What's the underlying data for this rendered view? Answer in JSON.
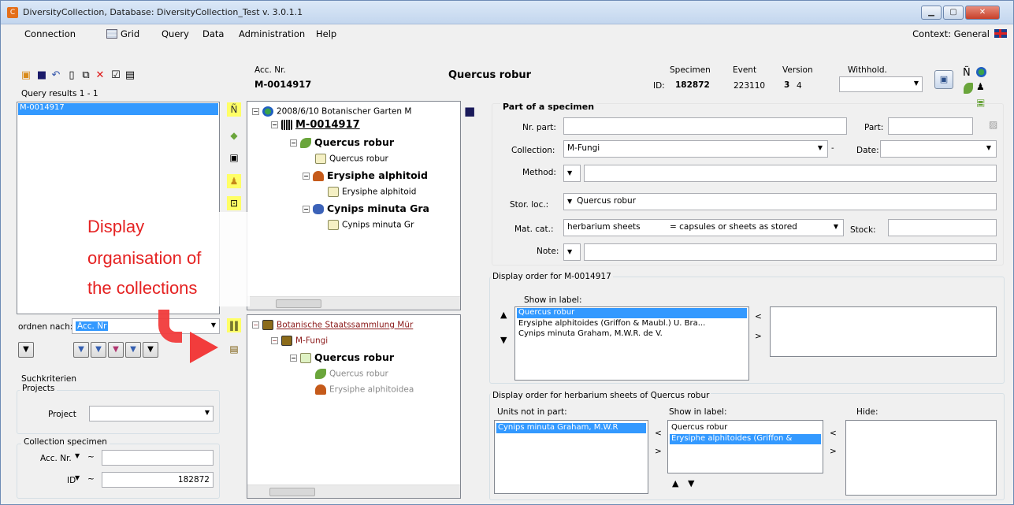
{
  "window": {
    "title": "DiversityCollection,  Database: DiversityCollection_Test   v. 3.0.1.1",
    "minimize": "▁",
    "maximize": "▢",
    "close": "✕"
  },
  "menu": [
    "Connection",
    "Grid",
    "Query",
    "Data",
    "Administration",
    "Help"
  ],
  "context": "Context: General",
  "header": {
    "acc_nr_label": "Acc. Nr.",
    "acc_nr_value": "M-0014917",
    "title": "Quercus robur",
    "id_label": "ID:",
    "specimen_label": "Specimen",
    "specimen_value": "182872",
    "event_label": "Event",
    "event_value": "223110",
    "version_label": "Version",
    "version_value": "3",
    "version_value2": "4",
    "withhold_label": "Withhold."
  },
  "query": {
    "results_label": "Query results   1 - 1",
    "results": [
      "M-0014917"
    ],
    "order_label": "ordnen nach:",
    "order_value": "Acc. Nr",
    "search_criteria_label": "Suchkriterien",
    "projects_group": "Projects",
    "project_label": "Project",
    "collection_specimen_group": "Collection specimen",
    "acc_nr_label": "Acc. Nr.",
    "id_label": "ID",
    "id_value": "182872",
    "tilde": "~"
  },
  "tree_top": {
    "event": "2008/6/10 Botanischer Garten M",
    "specimen": "M-0014917",
    "unit1": "Quercus robur",
    "unit1_label": "Quercus robur",
    "unit2": "Erysiphe alphitoid",
    "unit2_label": "Erysiphe alphitoid",
    "unit3": "Cynips minuta Gra",
    "unit3_label": "Cynips minuta Gr"
  },
  "tree_bottom": {
    "collection": "Botanische Staatssammlung Mür",
    "subcollection": "M-Fungi",
    "part": "Quercus robur",
    "unit1": "Quercus robur",
    "unit2": "Erysiphe alphitoidea"
  },
  "annotation": {
    "line1": "Display",
    "line2": "organisation of",
    "line3": "the collections"
  },
  "part": {
    "section_title": "Part of a specimen",
    "nr_part_label": "Nr. part:",
    "part_label": "Part:",
    "collection_label": "Collection:",
    "collection_value": "M-Fungi",
    "date_label": "Date:",
    "method_label": "Method:",
    "stor_loc_label": "Stor. loc.:",
    "stor_loc_value": "Quercus robur",
    "mat_cat_label": "Mat. cat.:",
    "mat_cat_value": "herbarium sheets",
    "mat_cat_desc": "= capsules or sheets as stored",
    "stock_label": "Stock:",
    "note_label": "Note:"
  },
  "display_order": {
    "title": "Display order for M-0014917",
    "show_in_label": "Show in label:",
    "items": [
      "Quercus robur",
      "Erysiphe alphitoides (Griffon & Maubl.) U. Bra...",
      "Cynips minuta Graham, M.W.R. de V."
    ],
    "left_arrow": "<",
    "right_arrow": ">"
  },
  "herbarium_order": {
    "title": "Display order for herbarium sheets of Quercus robur",
    "units_not_in_part_label": "Units not in part:",
    "units_not_in_part": [
      "Cynips minuta Graham, M.W.R"
    ],
    "show_in_label": "Show in label:",
    "show_items": [
      "Quercus robur",
      "Erysiphe alphitoides (Griffon &"
    ],
    "hide_label": "Hide:",
    "left_arrow": "<",
    "right_arrow": ">"
  },
  "colors": {
    "selection": "#3399ff",
    "annotation_red": "#e52222",
    "highlight_yellow": "#ffff66"
  }
}
